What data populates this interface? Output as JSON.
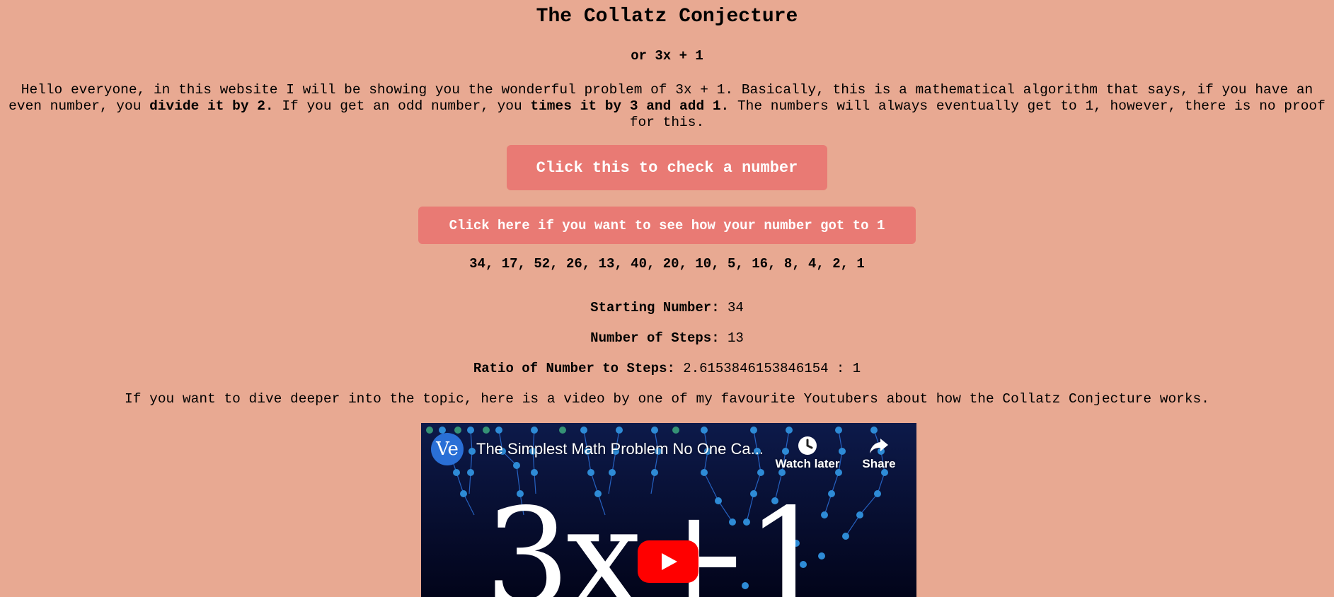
{
  "header": {
    "title": "The Collatz Conjecture",
    "subtitle": "or 3x + 1"
  },
  "intro": {
    "part1": "Hello everyone, in this website I will be showing you the wonderful problem of 3x + 1. Basically, this is a mathematical algorithm that says, if you have an even number, you ",
    "bold1": "divide it by 2.",
    "part2": " If you get an odd number, you ",
    "bold2": "times it by 3 and add 1.",
    "part3": " The numbers will always eventually get to 1, however, there is no proof for this."
  },
  "buttons": {
    "check_label": "Click this to check a number",
    "how_label": "Click here if you want to see how your number got to 1"
  },
  "sequence": "34, 17, 52, 26, 13, 40, 20, 10, 5, 16, 8, 4, 2, 1",
  "stats": {
    "starting_label": "Starting Number:",
    "starting_value": "34",
    "steps_label": "Number of Steps:",
    "steps_value": "13",
    "ratio_label": "Ratio of Number to Steps:",
    "ratio_value": "2.6153846153846154 : 1"
  },
  "deeper_text": "If you want to dive deeper into the topic, here is a video by one of my favourite Youtubers about how the Collatz Conjecture works.",
  "video": {
    "channel_initials": "Ve",
    "title": "The Simplest Math Problem No One Ca...",
    "watch_later": "Watch later",
    "share": "Share",
    "thumbnail_text": "3x+1",
    "icons": [
      "clock-icon",
      "share-icon",
      "play-icon"
    ],
    "play_color": "#ff0000"
  },
  "colors": {
    "background": "#e8a992",
    "button": "#e97a74",
    "button_text": "#ffffff"
  }
}
